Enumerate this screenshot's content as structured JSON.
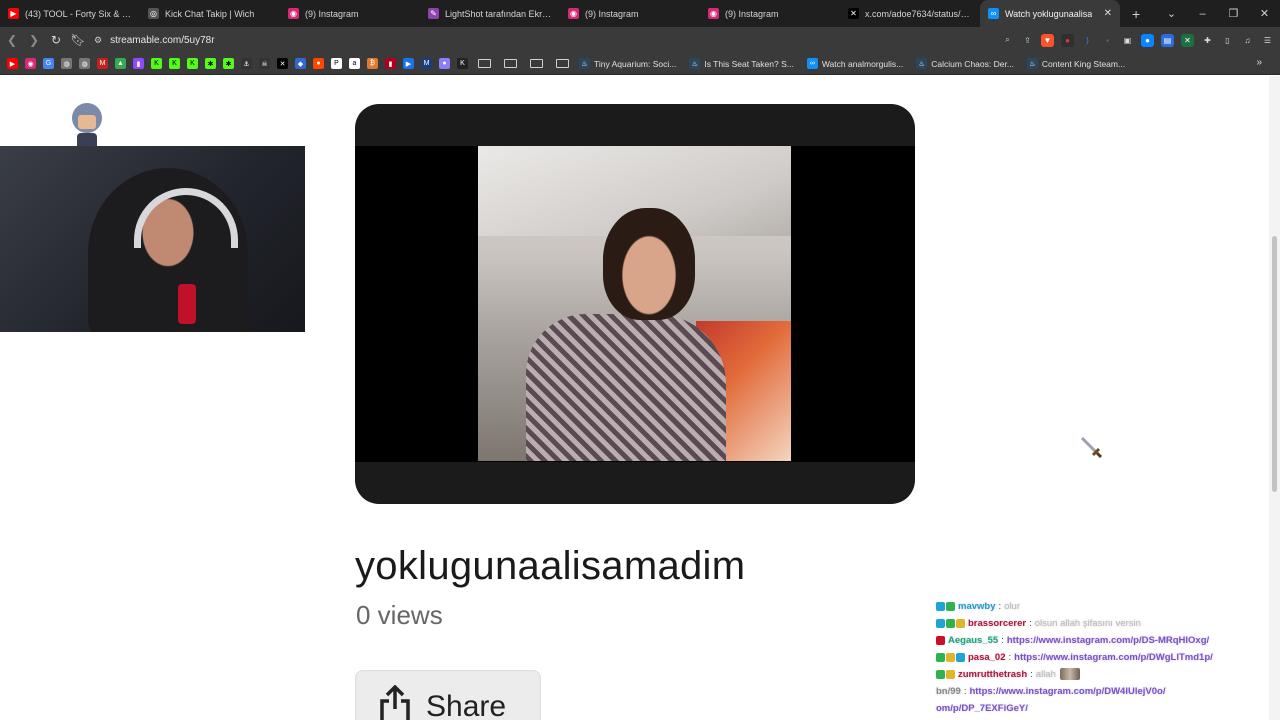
{
  "tabs": [
    {
      "title": "(43) TOOL - Forty Six & 2 (Offi",
      "favicon_color": "#ff0000",
      "favicon": "youtube-icon"
    },
    {
      "title": "Kick Chat Takip | Wich",
      "favicon_color": "#555555",
      "favicon": "globe-icon"
    },
    {
      "title": "(9) Instagram",
      "favicon_color": "#d62976",
      "favicon": "instagram-icon"
    },
    {
      "title": "LightShot tarafından Ekran Gö",
      "favicon_color": "#8e44ad",
      "favicon": "feather-icon"
    },
    {
      "title": "(9) Instagram",
      "favicon_color": "#d62976",
      "favicon": "instagram-icon"
    },
    {
      "title": "(9) Instagram",
      "favicon_color": "#d62976",
      "favicon": "instagram-icon"
    },
    {
      "title": "x.com/adoe7634/status/19253",
      "favicon_color": "#000000",
      "favicon": "x-icon"
    },
    {
      "title": "Watch yoklugunaalisa",
      "favicon_color": "#0f90fa",
      "favicon": "streamable-icon",
      "active": true
    }
  ],
  "address": {
    "url": "streamable.com/5uy78r"
  },
  "bookmarks": [
    {
      "label": "Tiny Aquarium: Soci..."
    },
    {
      "label": "Is This Seat Taken? S..."
    },
    {
      "label": "Watch analmorgulis..."
    },
    {
      "label": "Calcium Chaos: Der..."
    },
    {
      "label": "Content King Steam..."
    }
  ],
  "video": {
    "title": "yoklugunaalisamadim",
    "views": "0 views",
    "share_label": "Share"
  },
  "chat": [
    {
      "user": "mavwby",
      "sep": ":",
      "msg": "olur",
      "user_color": "#1f9bd6",
      "badges": [
        "#1ea5d8",
        "#2fb34f"
      ]
    },
    {
      "user": "brassorcerer",
      "sep": ":",
      "msg": "olsun allah şifasını versin",
      "user_color": "#b3123a",
      "badges": [
        "#1ea5d8",
        "#2fb34f",
        "#e0b52a"
      ]
    },
    {
      "user": "Aegaus_55",
      "sep": ":",
      "msg": "https://www.instagram.com/p/DS-MRqHlOxg/",
      "user_color": "#14a57c",
      "badges": [
        "#c8102e"
      ],
      "is_link": true
    },
    {
      "user": "pasa_02",
      "sep": ":",
      "msg": "https://www.instagram.com/p/DWgLlTmd1p/",
      "user_color": "#b3123a",
      "badges": [
        "#2fb34f",
        "#e0b52a",
        "#1ea5d8"
      ],
      "is_link": true
    },
    {
      "user": "zumrutthetrash",
      "sep": ":",
      "msg": "allah",
      "user_color": "#b3123a",
      "badges": [
        "#2fb34f",
        "#e0b52a"
      ],
      "emote": true
    },
    {
      "user": "bn/99",
      "sep": ":",
      "msg": "https://www.instagram.com/p/DW4lUlejV0o/",
      "user_color": "#8a8a8a",
      "badges": [],
      "is_link": true
    },
    {
      "user": "",
      "sep": "",
      "msg": "om/p/DP_7EXFiGeY/",
      "user_color": "#7b4fd0",
      "badges": [],
      "is_link": true
    }
  ],
  "colors": {
    "chrome_dark": "#1f1f1f",
    "chrome_mid": "#3a3a3a",
    "player_bg": "#1b1b1b",
    "link_purple": "#7b4fd0"
  }
}
